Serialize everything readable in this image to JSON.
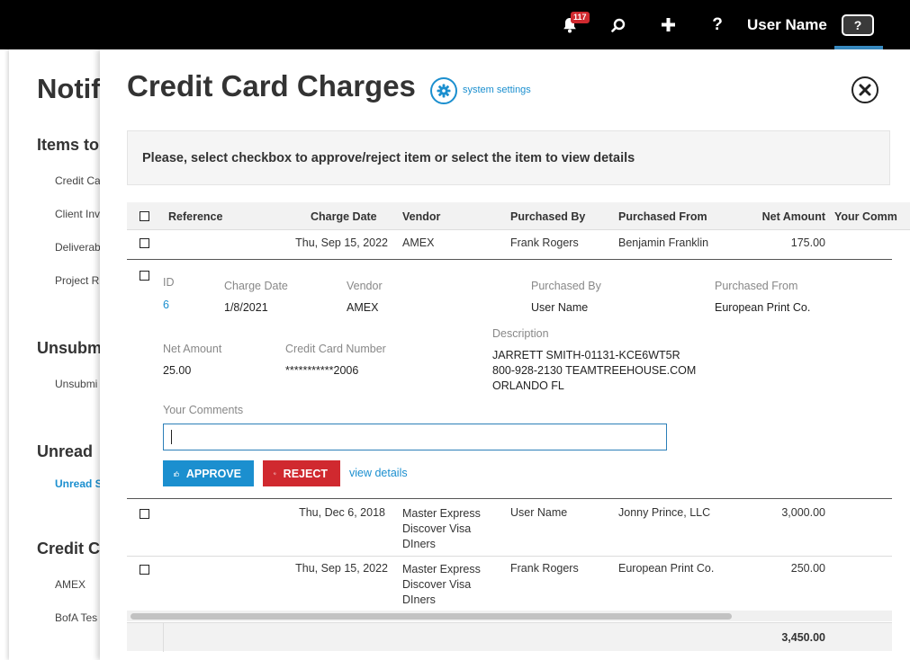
{
  "topbar": {
    "notification_count": "117",
    "help_label": "?",
    "user_name": "User Name",
    "help_box_label": "?"
  },
  "background": {
    "title": "Notifi",
    "sections": [
      {
        "title": "Items to",
        "items": [
          "Credit Ca",
          "Client Inv",
          "Deliverab",
          "Project R"
        ]
      },
      {
        "title": "Unsubm",
        "items": [
          "Unsubmi"
        ]
      },
      {
        "title": "Unread",
        "items": [
          "Unread S"
        ]
      },
      {
        "title": "Credit C",
        "items": [
          "AMEX",
          "BofA Tes"
        ]
      }
    ]
  },
  "panel": {
    "title": "Credit Card Charges",
    "system_settings": "system settings",
    "instruction": "Please, select checkbox to approve/reject item or select the item to view details"
  },
  "table": {
    "headers": [
      "Reference",
      "Charge Date",
      "Vendor",
      "Purchased By",
      "Purchased From",
      "Net Amount",
      "Your Comm"
    ],
    "rows": [
      {
        "reference": "",
        "charge_date": "Thu, Sep 15, 2022",
        "vendor": "AMEX",
        "purchased_by": "Frank Rogers",
        "purchased_from": "Benjamin Franklin",
        "net_amount": "175.00"
      },
      {
        "reference": "",
        "charge_date": "Thu, Dec 6, 2018",
        "vendor": "Master Express\nDiscover Visa\nDIners",
        "purchased_by": "User Name",
        "purchased_from": "Jonny Prince, LLC",
        "net_amount": "3,000.00"
      },
      {
        "reference": "",
        "charge_date": "Thu, Sep 15, 2022",
        "vendor": "Master Express\nDiscover Visa\nDIners",
        "purchased_by": "Frank Rogers",
        "purchased_from": "European Print Co.",
        "net_amount": "250.00"
      }
    ],
    "total": "3,450.00"
  },
  "detail": {
    "id_label": "ID",
    "id_value": "6",
    "charge_date_label": "Charge Date",
    "charge_date_value": "1/8/2021",
    "vendor_label": "Vendor",
    "vendor_value": "AMEX",
    "purchased_by_label": "Purchased By",
    "purchased_by_value": "User Name",
    "purchased_from_label": "Purchased From",
    "purchased_from_value": "European Print Co.",
    "net_amount_label": "Net Amount",
    "net_amount_value": "25.00",
    "card_number_label": "Credit Card Number",
    "card_number_value": "***********2006",
    "description_label": "Description",
    "description_value": "JARRETT SMITH-01131-KCE6WT5R\n800-928-2130 TEAMTREEHOUSE.COM\nORLANDO FL",
    "comments_label": "Your Comments",
    "comments_value": "",
    "approve_label": "APPROVE",
    "reject_label": "REJECT",
    "view_details_label": "view details"
  },
  "colors": {
    "accent": "#1b8fcf",
    "danger": "#d0292f",
    "topbar": "#000000"
  }
}
